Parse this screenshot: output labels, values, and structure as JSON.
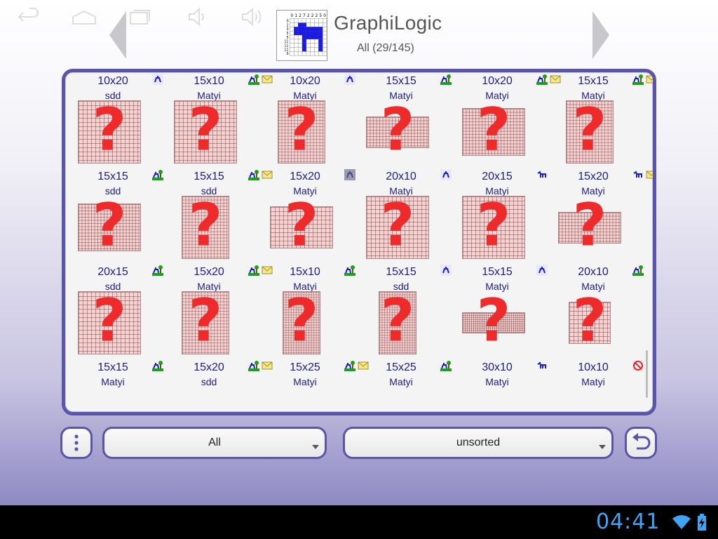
{
  "header": {
    "title": "GraphiLogic",
    "subtitle": "All (29/145)",
    "logo_icon": "nonogram-logo-icon",
    "prev_icon": "chevron-left-icon",
    "next_icon": "chevron-right-icon",
    "logo_row_clues": [
      "0",
      "1",
      "2",
      "7",
      "2",
      "2",
      "2",
      "5",
      "0"
    ],
    "logo_col_clues": [
      "0",
      "2",
      "3",
      "5",
      "5",
      "11",
      "11",
      "11",
      "9"
    ]
  },
  "colors": {
    "accent": "#5a55a8",
    "label_text": "#1e1a8a",
    "question_mark": "#ee2a2a",
    "clock": "#3fa4f4"
  },
  "puzzles": [
    {
      "size": "10x20",
      "author": "sdd",
      "icons": [
        "figure-icon"
      ]
    },
    {
      "size": "15x10",
      "author": "Matyi",
      "icons": [
        "figure-tree-icon",
        "envelope-icon"
      ]
    },
    {
      "size": "10x20",
      "author": "Matyi",
      "icons": [
        "figure-icon"
      ]
    },
    {
      "size": "15x15",
      "author": "Matyi",
      "icons": [
        "figure-tree-icon"
      ]
    },
    {
      "size": "10x20",
      "author": "Matyi",
      "icons": [
        "figure-tree-icon",
        "envelope-icon"
      ]
    },
    {
      "size": "15x15",
      "author": "Matyi",
      "icons": [
        "figure-tree-icon",
        "envelope-icon"
      ]
    },
    {
      "size": "15x15",
      "author": "sdd",
      "icons": [
        "figure-tree-icon"
      ]
    },
    {
      "size": "15x15",
      "author": "sdd",
      "icons": [
        "figure-tree-icon",
        "envelope-icon"
      ]
    },
    {
      "size": "15x20",
      "author": "Matyi",
      "icons": [
        "figure-gray-icon"
      ]
    },
    {
      "size": "20x10",
      "author": "Matyi",
      "icons": [
        "figure-icon"
      ]
    },
    {
      "size": "20x15",
      "author": "Matyi",
      "icons": [
        "dog-icon"
      ]
    },
    {
      "size": "15x20",
      "author": "Matyi",
      "icons": [
        "dog-icon",
        "envelope-icon"
      ]
    },
    {
      "size": "20x15",
      "author": "sdd",
      "icons": [
        "figure-tree-icon"
      ]
    },
    {
      "size": "15x20",
      "author": "Matyi",
      "icons": [
        "figure-tree-icon",
        "envelope-icon"
      ]
    },
    {
      "size": "15x10",
      "author": "Matyi",
      "icons": [
        "figure-tree-icon"
      ]
    },
    {
      "size": "15x15",
      "author": "sdd",
      "icons": [
        "figure-icon"
      ]
    },
    {
      "size": "15x15",
      "author": "Matyi",
      "icons": [
        "figure-icon"
      ]
    },
    {
      "size": "20x10",
      "author": "Matyi",
      "icons": [
        "figure-tree-icon"
      ]
    },
    {
      "size": "15x15",
      "author": "Matyi",
      "icons": [
        "figure-tree-icon"
      ]
    },
    {
      "size": "15x20",
      "author": "sdd",
      "icons": [
        "figure-tree-icon",
        "envelope-icon"
      ]
    },
    {
      "size": "15x25",
      "author": "Matyi",
      "icons": [
        "figure-tree-icon",
        "envelope-icon"
      ]
    },
    {
      "size": "15x25",
      "author": "Matyi",
      "icons": [
        "figure-tree-icon"
      ]
    },
    {
      "size": "30x10",
      "author": "Matyi",
      "icons": [
        "dog-icon"
      ]
    },
    {
      "size": "10x10",
      "author": "Matyi",
      "icons": [
        "no-entry-icon"
      ]
    }
  ],
  "controls": {
    "menu_icon": "overflow-menu-icon",
    "filter_value": "All",
    "sort_value": "unsorted",
    "undo_icon": "undo-icon"
  },
  "system_bar": {
    "back_icon": "back-icon",
    "home_icon": "home-icon",
    "recents_icon": "recents-icon",
    "vol_down_icon": "volume-down-icon",
    "vol_up_icon": "volume-up-icon",
    "clock": "04:41",
    "wifi_icon": "wifi-icon",
    "battery_icon": "battery-charging-icon"
  }
}
